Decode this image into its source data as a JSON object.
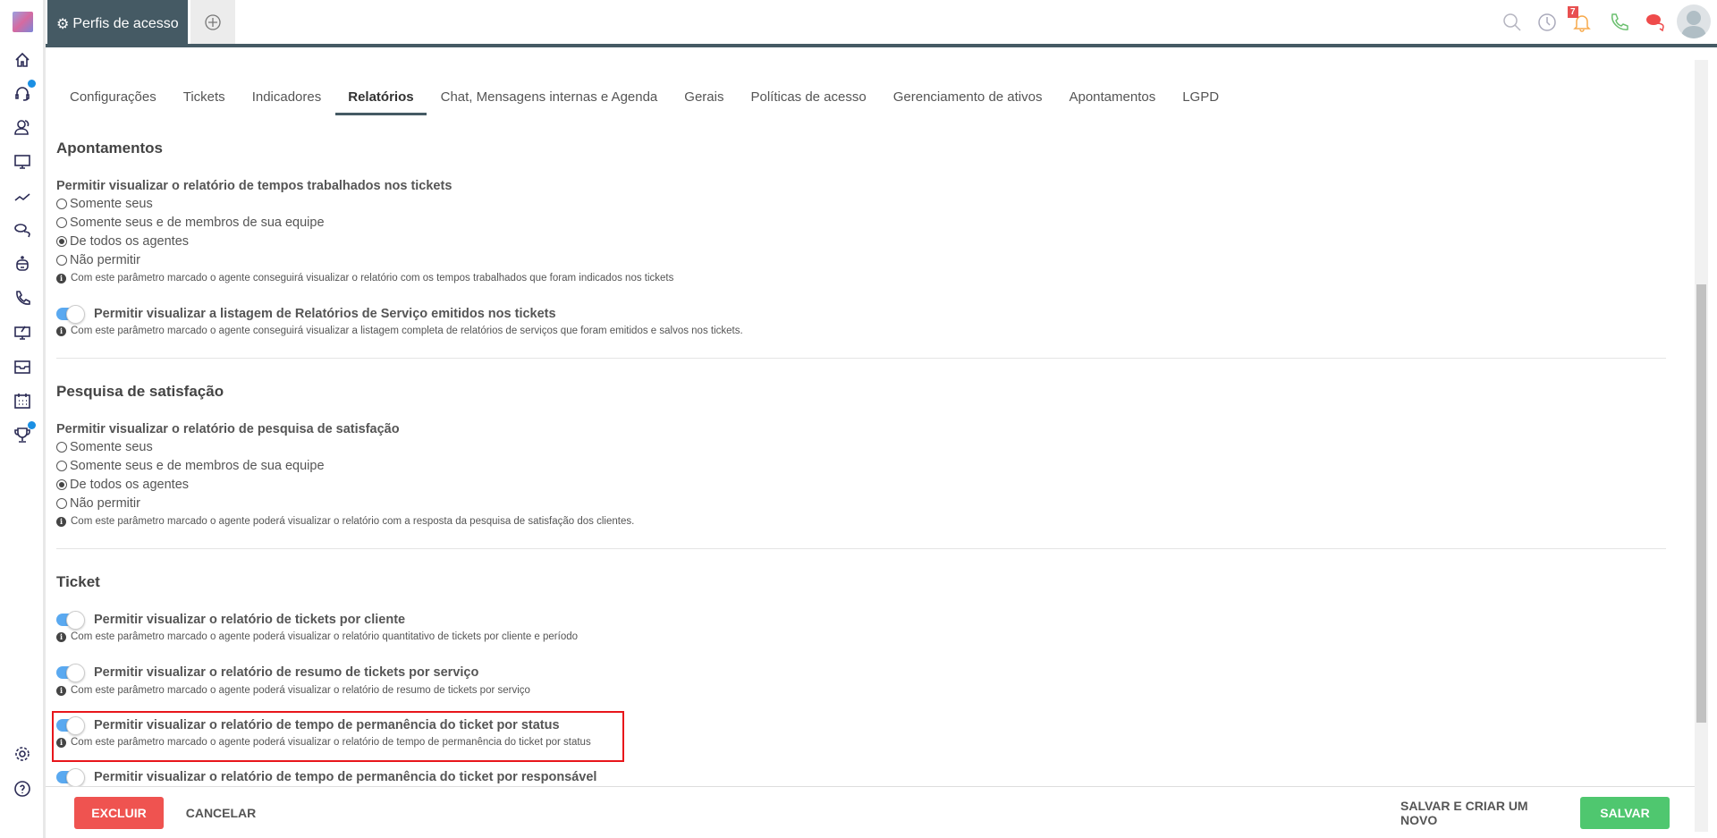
{
  "window": {
    "tab_title": "Perfis de acesso",
    "notification_count": "7"
  },
  "colors": {
    "accent": "#455a64",
    "toggle": "#5aa9f0",
    "danger": "#ef5350",
    "success": "#4fc76f",
    "highlight": "#e8161b"
  },
  "icons": {
    "sidebar": [
      "home-icon",
      "headset-icon",
      "contacts-icon",
      "monitor-icon",
      "chart-line-icon",
      "chat-icon",
      "robot-icon",
      "phone-icon",
      "remote-monitor-icon",
      "inbox-icon",
      "calendar-icon",
      "trophy-icon",
      "settings-icon",
      "help-icon"
    ],
    "topbar": [
      "search-icon",
      "clock-icon",
      "bell-icon",
      "phone-icon",
      "chat-bubbles-icon",
      "avatar"
    ]
  },
  "tabs": [
    "Configurações",
    "Tickets",
    "Indicadores",
    "Relatórios",
    "Chat, Mensagens internas e Agenda",
    "Gerais",
    "Políticas de acesso",
    "Gerenciamento de ativos",
    "Apontamentos",
    "LGPD"
  ],
  "active_tab": "Relatórios",
  "sections": {
    "apontamentos": {
      "title": "Apontamentos",
      "question": "Permitir visualizar o relatório de tempos trabalhados nos tickets",
      "options": [
        "Somente seus",
        "Somente seus e de membros de sua equipe",
        "De todos os agentes",
        "Não permitir"
      ],
      "selected": "De todos os agentes",
      "info": "Com este parâmetro marcado o agente conseguirá visualizar o relatório com os tempos trabalhados que foram indicados nos tickets",
      "toggle_label": "Permitir visualizar a listagem de Relatórios de Serviço emitidos nos tickets",
      "toggle_on": true,
      "toggle_info": "Com este parâmetro marcado o agente conseguirá visualizar a listagem completa de relatórios de serviços que foram emitidos e salvos nos tickets."
    },
    "pesquisa": {
      "title": "Pesquisa de satisfação",
      "question": "Permitir visualizar o relatório de pesquisa de satisfação",
      "options": [
        "Somente seus",
        "Somente seus e de membros de sua equipe",
        "De todos os agentes",
        "Não permitir"
      ],
      "selected": "De todos os agentes",
      "info": "Com este parâmetro marcado o agente poderá visualizar o relatório com a resposta da pesquisa de satisfação dos clientes."
    },
    "ticket": {
      "title": "Ticket",
      "toggles": [
        {
          "label": "Permitir visualizar o relatório de tickets por cliente",
          "info": "Com este parâmetro marcado o agente poderá visualizar o relatório quantitativo de tickets por cliente e período",
          "on": true
        },
        {
          "label": "Permitir visualizar o relatório de resumo de tickets por serviço",
          "info": "Com este parâmetro marcado o agente poderá visualizar o relatório de resumo de tickets por serviço",
          "on": true
        },
        {
          "label": "Permitir visualizar o relatório de tempo de permanência do ticket por status",
          "info": "Com este parâmetro marcado o agente poderá visualizar o relatório de tempo de permanência do ticket por status",
          "on": true
        },
        {
          "label": "Permitir visualizar o relatório de tempo de permanência do ticket por responsável",
          "on": true
        }
      ]
    }
  },
  "footer": {
    "delete": "EXCLUIR",
    "cancel": "CANCELAR",
    "save_new": "SALVAR E CRIAR UM NOVO",
    "save": "SALVAR"
  }
}
